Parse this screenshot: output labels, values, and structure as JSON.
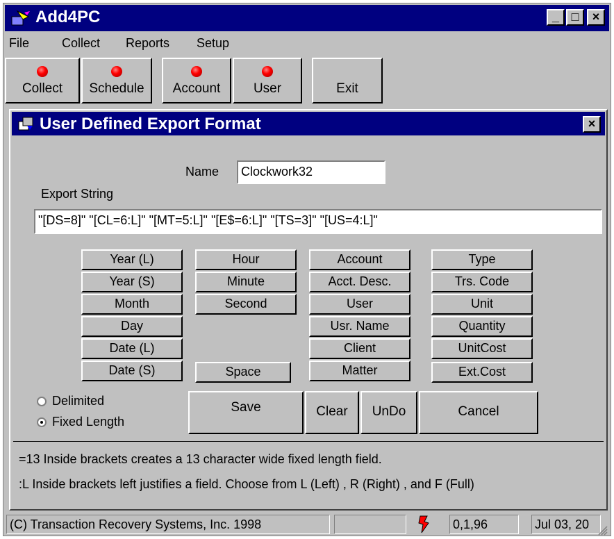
{
  "app": {
    "title": "Add4PC"
  },
  "window_buttons": {
    "minimize": "_",
    "maximize": "□",
    "close": "×"
  },
  "menu": [
    "File",
    "Collect",
    "Reports",
    "Setup"
  ],
  "toolbar": [
    "Collect",
    "Schedule",
    "Account",
    "User",
    "Exit"
  ],
  "dialog": {
    "title": "User Defined Export Format",
    "close": "×",
    "name_label": "Name",
    "name_value": "Clockwork32",
    "export_label": "Export String",
    "export_value": "\"[DS=8]\" \"[CL=6:L]\" \"[MT=5:L]\" \"[E$=6:L]\" \"[TS=3]\" \"[US=4:L]\"",
    "fields": {
      "col1": [
        "Year (L)",
        "Year (S)",
        "Month",
        "Day",
        "Date (L)",
        "Date (S)"
      ],
      "col2": [
        "Hour",
        "Minute",
        "Second",
        "Space"
      ],
      "col3": [
        "Account",
        "Acct. Desc.",
        "User",
        "Usr. Name",
        "Client",
        "Matter"
      ],
      "col4": [
        "Type",
        "Trs. Code",
        "Unit",
        "Quantity",
        "UnitCost",
        "Ext.Cost"
      ]
    },
    "radios": {
      "delimited": "Delimited",
      "fixed": "Fixed Length",
      "selected": "fixed"
    },
    "actions": {
      "save": "Save",
      "clear": "Clear",
      "undo": "UnDo",
      "cancel": "Cancel"
    },
    "help": [
      "=13  Inside brackets creates a 13 character wide fixed length field.",
      ":L    Inside brackets left justifies a field. Choose from L (Left) , R (Right) , and F (Full)"
    ]
  },
  "status": {
    "copyright": "(C) Transaction Recovery Systems, Inc. 1998",
    "version": "0,1,96",
    "date": "Jul 03, 20"
  },
  "colors": {
    "titlebar": "#000080",
    "face": "#c0c0c0",
    "led": "#ff0000"
  }
}
